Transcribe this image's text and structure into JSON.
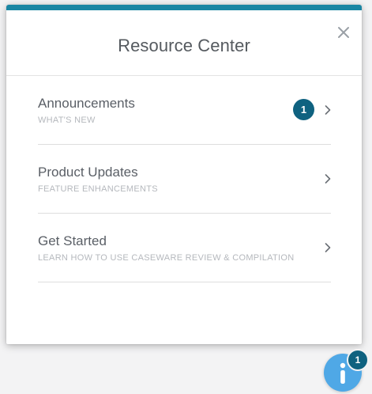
{
  "panel": {
    "title": "Resource Center",
    "accent_color": "#1a86a3",
    "close_icon": "close-icon"
  },
  "items": [
    {
      "title": "Announcements",
      "subtitle": "WHAT'S NEW",
      "badge": "1"
    },
    {
      "title": "Product Updates",
      "subtitle": "FEATURE ENHANCEMENTS"
    },
    {
      "title": "Get Started",
      "subtitle": "LEARN HOW TO USE CASEWARE REVIEW & COMPILATION"
    }
  ],
  "launcher": {
    "icon": "info-icon",
    "badge": "1",
    "color": "#4fa8e6"
  }
}
